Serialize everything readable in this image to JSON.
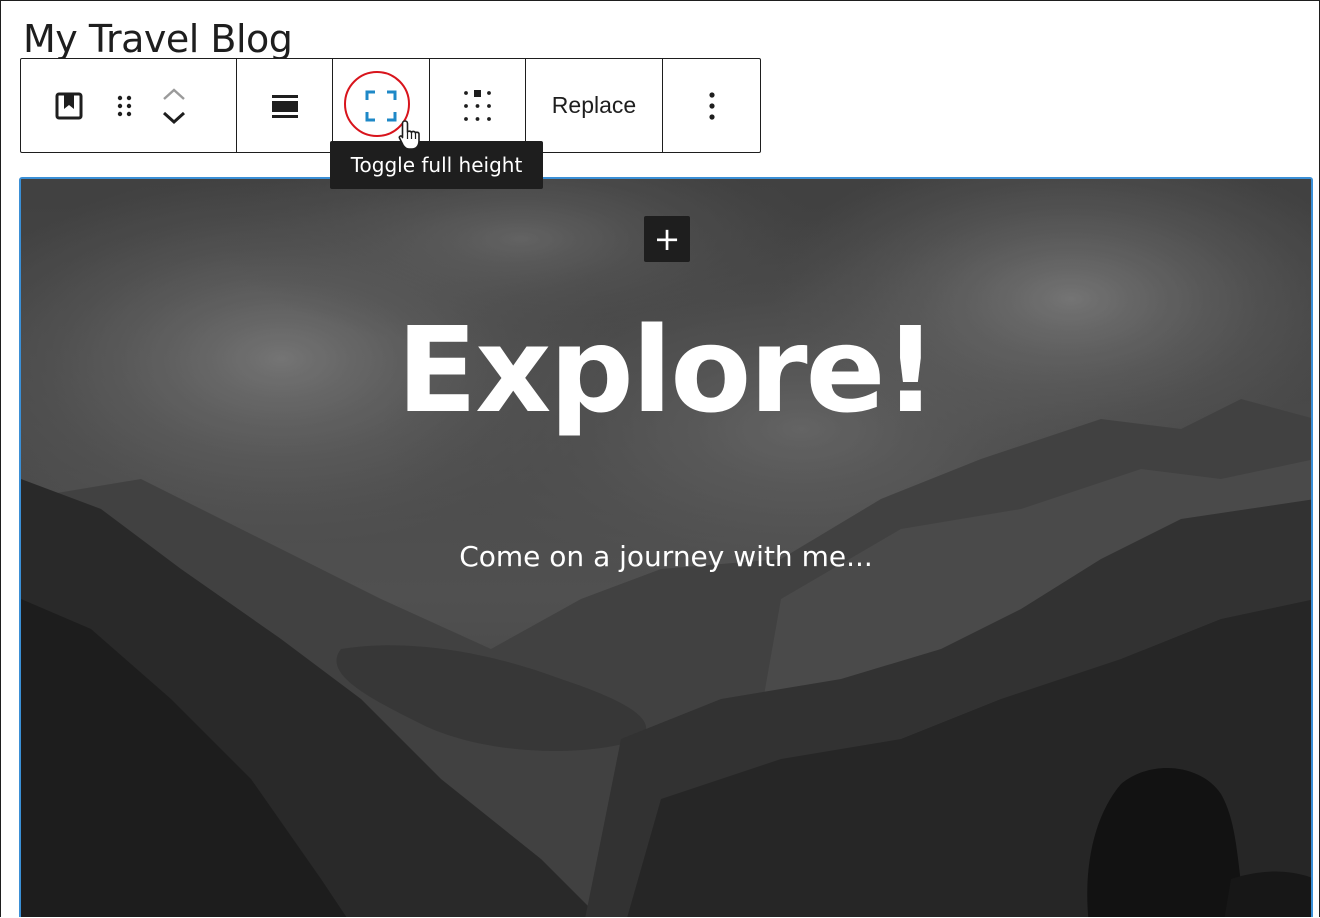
{
  "post": {
    "title": "My Travel Blog"
  },
  "toolbar": {
    "block_icon": "cover-block-icon",
    "drag_icon": "drag-handle-icon",
    "move_up_icon": "chevron-up-icon",
    "move_down_icon": "chevron-down-icon",
    "align_icon": "align-wide-icon",
    "full_height_icon": "fullscreen-icon",
    "position_icon": "matrix-position-icon",
    "replace_label": "Replace",
    "more_icon": "more-vertical-icon",
    "tooltip": "Toggle full height"
  },
  "cover": {
    "inserter_label": "+",
    "heading": "Explore!",
    "subheading": "Come on a journey with me..."
  },
  "colors": {
    "accent": "#3a8fd6",
    "highlight": "#d8141c",
    "toolbar_border": "#1e1e1e",
    "tooltip_bg": "#1e1e1e"
  }
}
